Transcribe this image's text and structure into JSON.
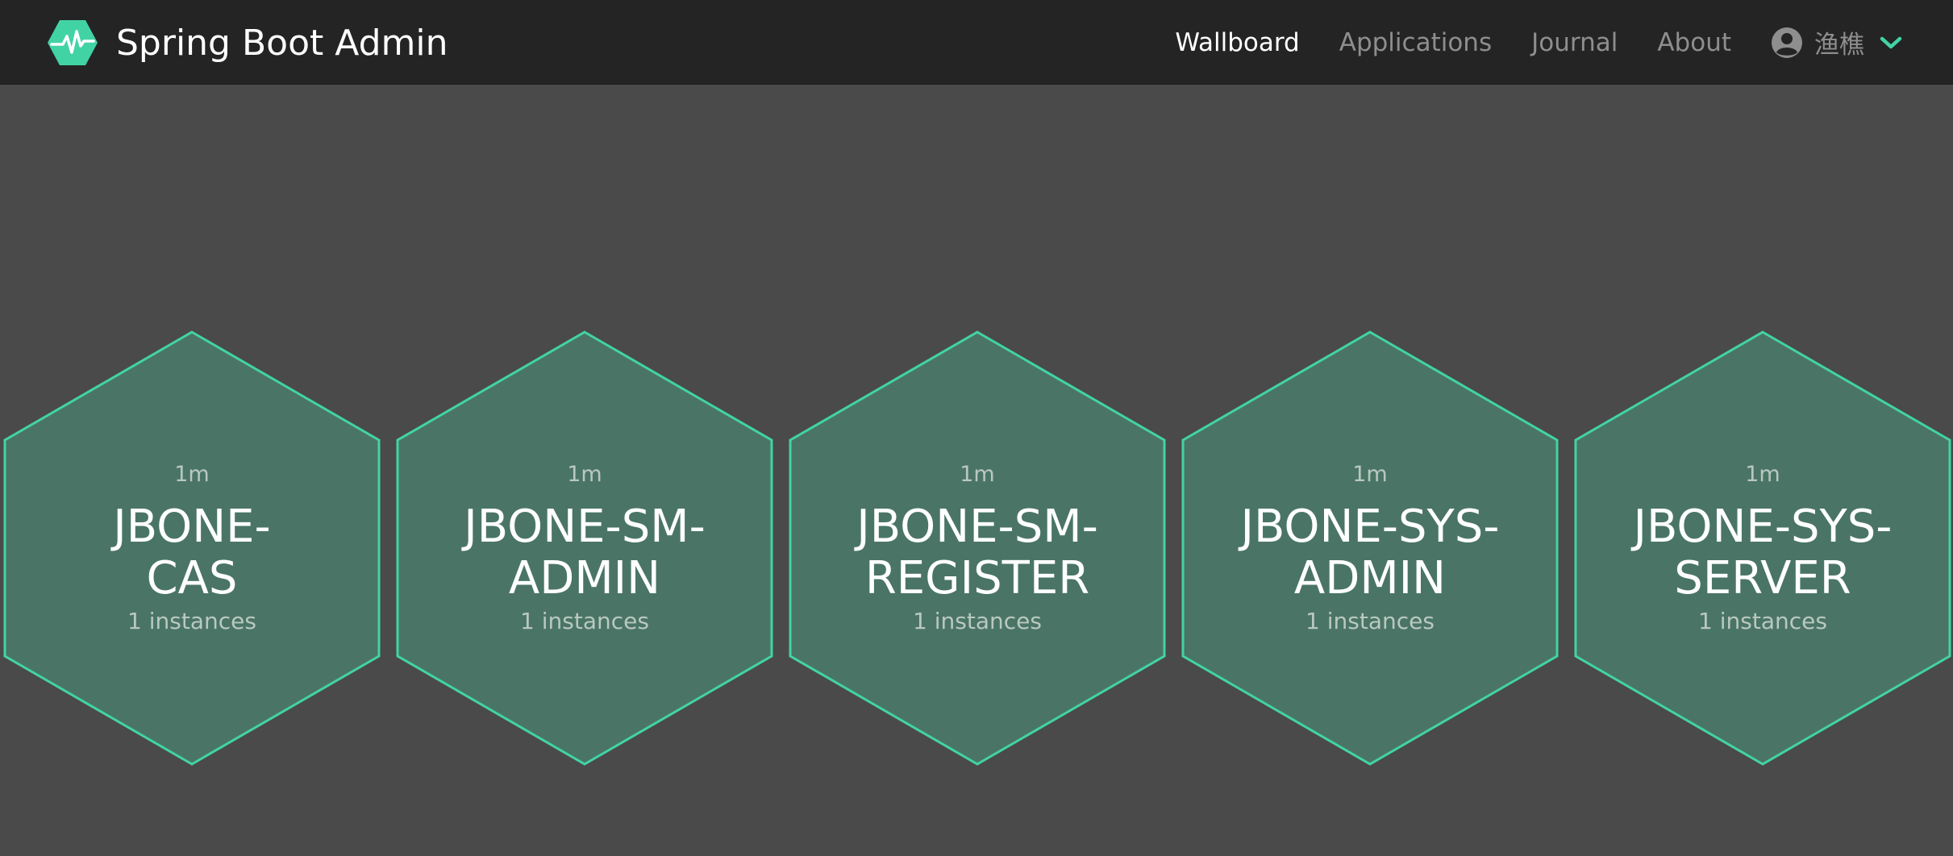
{
  "brand": {
    "title": "Spring Boot Admin"
  },
  "nav": {
    "items": [
      {
        "label": "Wallboard",
        "active": true
      },
      {
        "label": "Applications",
        "active": false
      },
      {
        "label": "Journal",
        "active": false
      },
      {
        "label": "About",
        "active": false
      }
    ],
    "user": {
      "name": "渔樵",
      "icon": "user-circle-icon",
      "dropdown_icon": "chevron-down-icon"
    }
  },
  "colors": {
    "accent": "#42d3a5",
    "navbar": "#242424",
    "background": "#4a4a4a",
    "hex_fill": "#4a7566",
    "hex_stroke": "#42d3a5"
  },
  "applications": [
    {
      "time": "1m",
      "name": "JBONE-CAS",
      "instances": "1 instances"
    },
    {
      "time": "1m",
      "name": "JBONE-SM-ADMIN",
      "instances": "1 instances"
    },
    {
      "time": "1m",
      "name": "JBONE-SM-REGISTER",
      "instances": "1 instances"
    },
    {
      "time": "1m",
      "name": "JBONE-SYS-ADMIN",
      "instances": "1 instances"
    },
    {
      "time": "1m",
      "name": "JBONE-SYS-SERVER",
      "instances": "1 instances"
    }
  ]
}
